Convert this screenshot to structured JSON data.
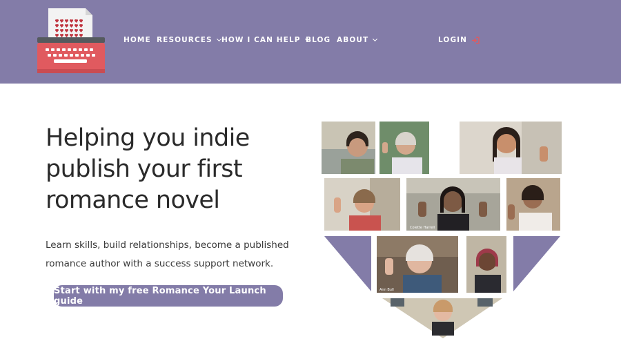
{
  "header": {
    "logo": {
      "icon": "typewriter-heart-logo"
    },
    "nav": [
      {
        "label": "HOME",
        "dropdown": false
      },
      {
        "label": "RESOURCES",
        "dropdown": true
      },
      {
        "label": "HOW I CAN HELP",
        "dropdown": true
      },
      {
        "label": "BLOG",
        "dropdown": false
      },
      {
        "label": "ABOUT",
        "dropdown": true
      }
    ],
    "login": {
      "label": "LOGIN",
      "icon": "login-arrow-icon"
    }
  },
  "hero": {
    "title_lines": [
      "Helping you indie",
      "publish your first",
      "romance novel"
    ],
    "subtitle_lines": [
      "Learn skills, build relationships, become a published",
      "romance author with a success support network."
    ],
    "cta_label": "Start with my free Romance Your Launch guide"
  },
  "collage": {
    "name_tags": [
      "Colette Harrell",
      "Ann Bull"
    ]
  },
  "colors": {
    "header_bg": "#837ca8",
    "button_bg": "#837ca8",
    "accent_red": "#e05a5f",
    "text_dark": "#2a2a2a"
  }
}
